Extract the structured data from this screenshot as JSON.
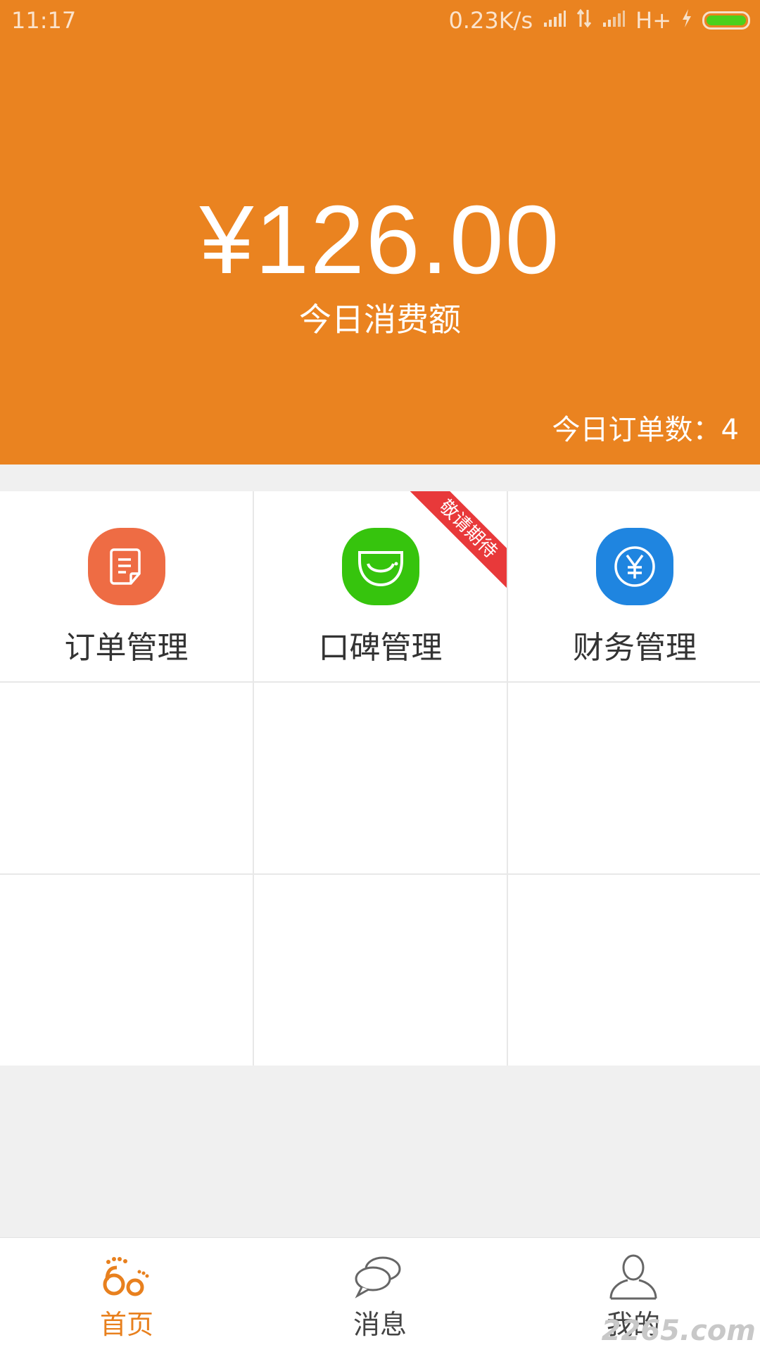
{
  "status_bar": {
    "time": "11:17",
    "network_speed": "0.23K/s",
    "network_type": "H+",
    "icons": [
      "signal-icon",
      "data-transfer-icon",
      "signal-icon",
      "charging-icon",
      "battery-icon"
    ]
  },
  "summary": {
    "amount": "¥126.00",
    "amount_label": "今日消费额",
    "order_count_text": "今日订单数：4"
  },
  "features": [
    {
      "label": "订单管理",
      "icon": "document-icon",
      "color": "#ee6c44"
    },
    {
      "label": "口碑管理",
      "icon": "smile-bag-icon",
      "color": "#36c40d",
      "ribbon": "敬请期待"
    },
    {
      "label": "财务管理",
      "icon": "yen-coin-icon",
      "color": "#1f85e0"
    }
  ],
  "tabs": [
    {
      "label": "首页",
      "icon": "footprint-logo-icon",
      "active": true
    },
    {
      "label": "消息",
      "icon": "chat-bubbles-icon",
      "active": false
    },
    {
      "label": "我的",
      "icon": "user-profile-icon",
      "active": false
    }
  ],
  "colors": {
    "brand_orange": "#ea8320",
    "ribbon_red": "#e8393a",
    "active_tab": "#e8801e"
  },
  "watermark": "2265.com"
}
